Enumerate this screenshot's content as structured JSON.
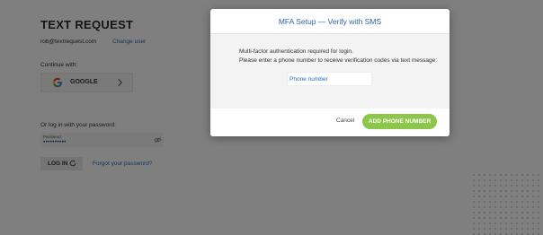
{
  "login": {
    "brand": "TEXT REQUEST",
    "email": "rob@textrequest.com",
    "change_user": "Change user",
    "continue_with": "Continue with:",
    "google_label": "GOOGLE",
    "password_prompt": "Or log in with your password:",
    "password_field_label": "Password",
    "password_mask": "••••••••••",
    "login_button": "LOG IN",
    "forgot_password": "Forgot your password?"
  },
  "modal": {
    "title": "MFA Setup — Verify with SMS",
    "line1": "Multi-factor authentication required for login.",
    "line2": "Please enter a phone number to receive verification codes via text message:",
    "phone_placeholder": "Phone number",
    "phone_value": "",
    "cancel_label": "Cancel",
    "submit_label": "ADD PHONE NUMBER"
  },
  "colors": {
    "accent_blue": "#2b63b0",
    "submit_green": "#8cc64a",
    "overlay": "rgba(0,0,0,0.5)"
  },
  "icons": {
    "google": "google-icon",
    "chevron": "chevron-right-icon",
    "eye": "eye-off-icon",
    "spinner": "refresh-icon"
  }
}
